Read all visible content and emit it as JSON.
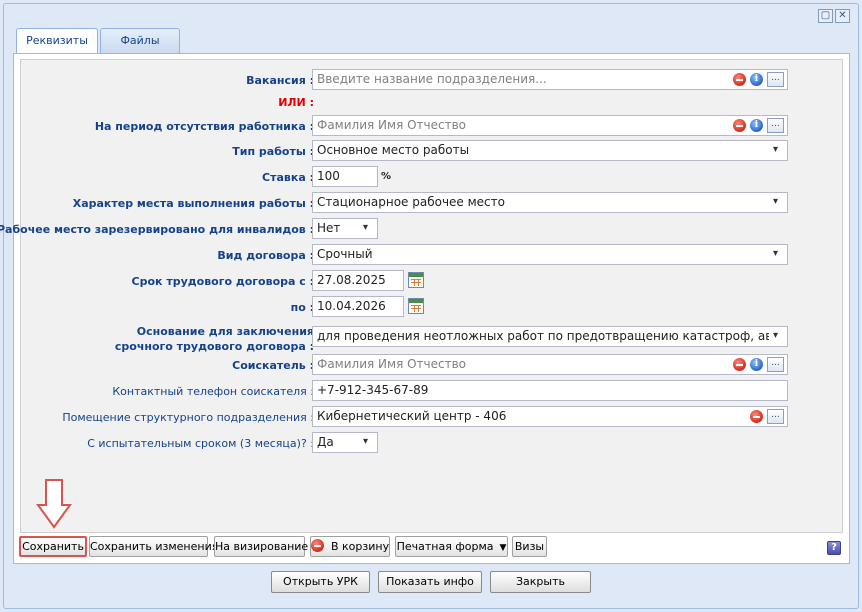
{
  "window": {
    "tools": [
      "▢",
      "✕"
    ]
  },
  "tabs": [
    {
      "label": "Реквизиты",
      "active": true
    },
    {
      "label": "Файлы",
      "active": false
    }
  ],
  "form": {
    "vacancy": {
      "label": "Вакансия :",
      "placeholder": "Введите название подразделения..."
    },
    "or": {
      "label": "ИЛИ :"
    },
    "absence_period": {
      "label": "На период отсутствия работника :",
      "placeholder": "Фамилия Имя Отчество"
    },
    "work_type": {
      "label": "Тип работы :",
      "value": "Основное место работы"
    },
    "rate": {
      "label": "Ставка :",
      "value": "100",
      "unit": "%"
    },
    "workplace_nature": {
      "label": "Характер места выполнения работы :",
      "value": "Стационарное рабочее место"
    },
    "reserved_disabled": {
      "label": "Рабочее место зарезервировано для инвалидов :",
      "value": "Нет"
    },
    "contract_type": {
      "label": "Вид договора :",
      "value": "Срочный"
    },
    "contract_from": {
      "label": "Срок трудового договора с :",
      "value": "27.08.2025"
    },
    "contract_to": {
      "label": "по :",
      "value": "10.04.2026"
    },
    "fixed_term_basis": {
      "label_line1": "Основание для заключения",
      "label_line2": "срочного трудового договора :",
      "value": "для проведения неотложных работ по предотвращению катастроф, аварий, несчастных случаев"
    },
    "applicant": {
      "label": "Соискатель :",
      "placeholder": "Фамилия Имя Отчество"
    },
    "applicant_phone": {
      "label": "Контактный телефон соискателя :",
      "value": "+7-912-345-67-89"
    },
    "room": {
      "label": "Помещение структурного подразделения :",
      "value": "Кибернетический центр - 406"
    },
    "probation": {
      "label": "С испытательным сроком (3 месяца)? :",
      "value": "Да"
    }
  },
  "toolbar": {
    "save": "Сохранить",
    "save_changes": "Сохранить изменения",
    "to_approval": "На визирование",
    "to_trash": "В корзину",
    "print_form": "Печатная форма",
    "visas": "Визы",
    "help": "?"
  },
  "footer": {
    "open_urk": "Открыть УРК",
    "show_info": "Показать инфо",
    "close": "Закрыть"
  },
  "colors": {
    "label_blue": "#15428b",
    "or_red": "#dd0000",
    "highlight_red": "#d9534f",
    "window_bg": "#dfe8f6"
  }
}
